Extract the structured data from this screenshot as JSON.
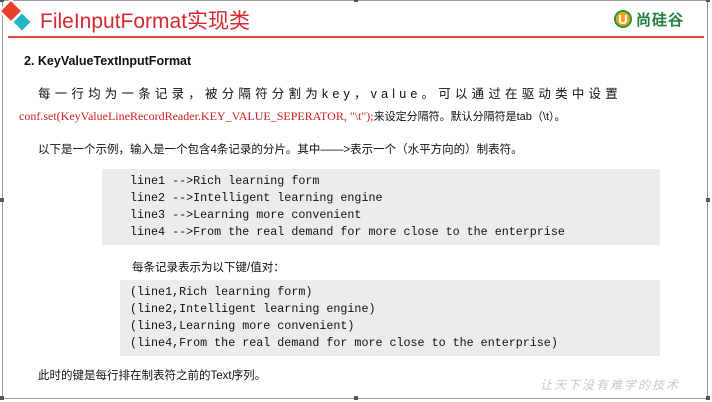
{
  "header": {
    "title": "FileInputFormat实现类",
    "logo_mark": "U",
    "logo_text": "尚硅谷"
  },
  "content": {
    "heading": "2. KeyValueTextInputFormat",
    "para1_line1": "每一行均为一条记录，被分隔符分割为key，value。可以通过在驱动类中设置",
    "para1_code": "conf.set(KeyValueLineRecordReader.KEY_VALUE_SEPERATOR, \"\\t\");",
    "para1_rest": "来设定分隔符。默认分隔符是tab（\\t）。",
    "para2": "以下是一个示例，输入是一个包含4条记录的分片。其中——>表示一个（水平方向的）制表符。",
    "input_lines": [
      "line1 -->Rich learning form",
      "line2 -->Intelligent learning engine",
      "line3 -->Learning more convenient",
      "line4 -->From the real demand for more close to the enterprise"
    ],
    "para3": "每条记录表示为以下键/值对：",
    "output_lines": [
      "(line1,Rich learning form)",
      "(line2,Intelligent learning engine)",
      "(line3,Learning more convenient)",
      "(line4,From the real demand for more close to the enterprise)"
    ],
    "para4": "此时的键是每行排在制表符之前的Text序列。",
    "watermark": "让天下没有难学的技术"
  },
  "colors": {
    "title": "#d7282f",
    "header_line": "#e04b3b",
    "code_bg": "#ececec",
    "code_red": "#cc1f1f"
  }
}
